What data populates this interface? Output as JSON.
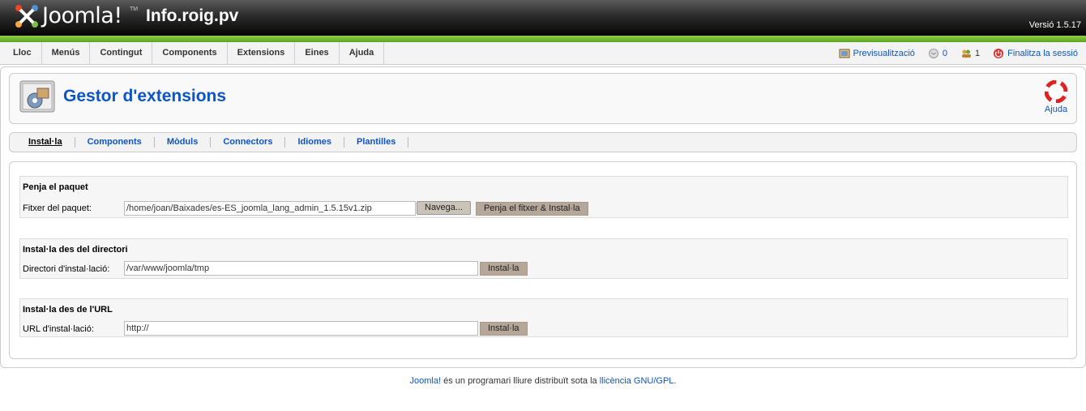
{
  "header": {
    "logo_text": "Joomla!",
    "logo_tm": "TM",
    "site_name": "Info.roig.pv",
    "version": "Versió 1.5.17"
  },
  "menu": [
    "Lloc",
    "Menús",
    "Contingut",
    "Components",
    "Extensions",
    "Eines",
    "Ajuda"
  ],
  "status": {
    "preview": "Previsualització",
    "messages_count": "0",
    "users_count": "1",
    "logout": "Finalitza la sessió"
  },
  "toolbar": {
    "title": "Gestor d'extensions",
    "help": "Ajuda"
  },
  "submenu": [
    "Instal·la",
    "Components",
    "Mòduls",
    "Connectors",
    "Idiomes",
    "Plantilles"
  ],
  "upload": {
    "title": "Penja el paquet",
    "label": "Fitxer del paquet:",
    "value": "/home/joan/Baixades/es-ES_joomla_lang_admin_1.5.15v1.zip",
    "browse": "Navega...",
    "submit": "Penja el fitxer & Instal·la"
  },
  "directory": {
    "title": "Instal·la des del directori",
    "label": "Directori d'instal·lació:",
    "value": "/var/www/joomla/tmp",
    "submit": "Instal·la"
  },
  "url": {
    "title": "Instal·la des de l'URL",
    "label": "URL d'instal·lació:",
    "value": "http://",
    "submit": "Instal·la"
  },
  "footer": {
    "link1": "Joomla!",
    "text": " és un programari lliure distribuït sota la ",
    "link2": "llicència GNU/GPL",
    "end": "."
  }
}
